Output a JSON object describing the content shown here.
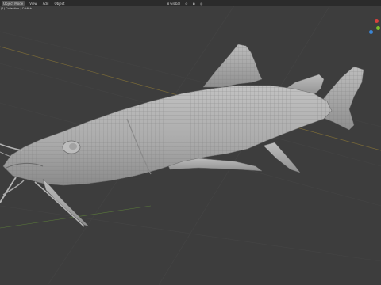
{
  "header": {
    "mode": "Object Mode",
    "menus": [
      "View",
      "Add",
      "Object"
    ],
    "transform_orientation": "Global",
    "pivot_icon": "pivot-icon",
    "snap_icon": "magnet-icon",
    "proportional_icon": "proportional-edit-icon"
  },
  "viewport": {
    "label": "(1) Collection | Catfish",
    "background_color": "#3d3d3d",
    "grid_color": "#464646",
    "x_axis_color": "#7a6a38",
    "y_axis_color": "#5a7a3a"
  },
  "model": {
    "name": "catfish-mesh",
    "mesh_color": "#b3b3b3",
    "wire_color": "#7d7d7d"
  },
  "gizmo": {
    "colors": {
      "x": "#d8413d",
      "y": "#7cbd2a",
      "z": "#3b86d6"
    }
  }
}
